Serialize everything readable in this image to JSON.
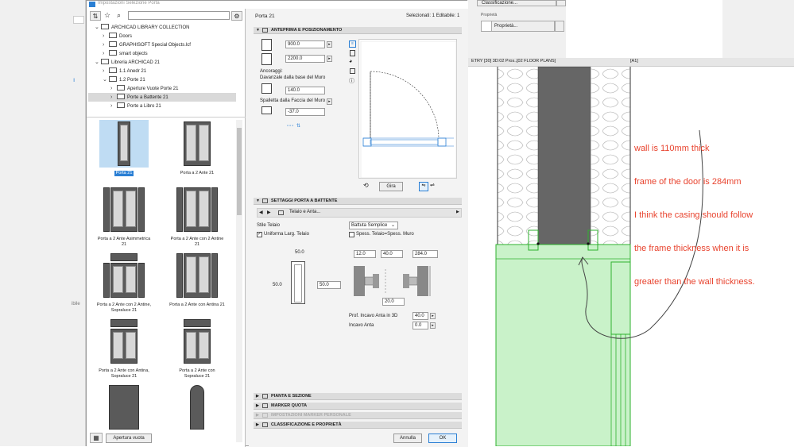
{
  "dialog": {
    "title": "Impostazioni Selezione Porta",
    "selection_info": "Selezionati: 1 Editabile: 1",
    "object_name": "Porta 21"
  },
  "library_tree": [
    {
      "label": "ARCHICAD LIBRARY COLLECTION",
      "indent": 0,
      "expanded": true,
      "selected": false
    },
    {
      "label": "Doors",
      "indent": 1,
      "expanded": false,
      "selected": false
    },
    {
      "label": "GRAPHISOFT Special Objects.lcf",
      "indent": 1,
      "expanded": false,
      "selected": false
    },
    {
      "label": "smart objects",
      "indent": 1,
      "expanded": false,
      "selected": false
    },
    {
      "label": "Libreria ARCHICAD 21",
      "indent": 0,
      "expanded": true,
      "selected": false
    },
    {
      "label": "1.1 Anedr 21",
      "indent": 1,
      "expanded": false,
      "selected": false
    },
    {
      "label": "1.2 Porte 21",
      "indent": 1,
      "expanded": true,
      "selected": false
    },
    {
      "label": "Aperture Vuote Porte 21",
      "indent": 2,
      "expanded": false,
      "selected": false
    },
    {
      "label": "Porte a Battente 21",
      "indent": 2,
      "expanded": false,
      "selected": true
    },
    {
      "label": "Porte a Libro 21",
      "indent": 2,
      "expanded": false,
      "selected": false
    }
  ],
  "thumbnails": [
    {
      "caption": "Porta 21",
      "selected": true
    },
    {
      "caption": "Porta a 2 Ante 21",
      "selected": false
    },
    {
      "caption": "Porta a 2 Ante Asimmetrica 21",
      "selected": false
    },
    {
      "caption": "Porta a 2 Ante con 2 Antine 21",
      "selected": false
    },
    {
      "caption": "Porta a 2 Ante con 2 Antine, Sopraluce 21",
      "selected": false
    },
    {
      "caption": "Porta a 2 Ante con Antina 21",
      "selected": false
    },
    {
      "caption": "Porta a 2 Ante con Antina, Sopraluce 21",
      "selected": false
    },
    {
      "caption": "Porta a 2 Ante con Sopraluce 21",
      "selected": false
    }
  ],
  "bottom_left_button": "Apertura vuota",
  "preview_section": {
    "title": "ANTEPRIMA E POSIZIONAMENTO",
    "width_value": "900.0",
    "height_value": "2200.0",
    "anchor_label": "Ancoraggi:",
    "sill_label": "Davanzale dalla base del Muro",
    "sill_value": "140.0",
    "reveal_label": "Spalletta dalla Faccia del Muro",
    "reveal_value": "-37.0",
    "rotate_button": "Gira"
  },
  "door_settings": {
    "title": "SETTAGGI PORTA A BATTENTE",
    "page_label": "Telaio e Anta...",
    "frame_style_label": "Stile Telaio",
    "frame_style_value": "Battuta Semplice",
    "uniform_label": "Uniforma Larg. Telaio",
    "uniform_checked": true,
    "thickness_label": "Spess. Telaio=Spess. Muro",
    "thickness_checked": false,
    "frame_top": "50.0",
    "frame_left": "50.0",
    "frame_right": "50.0",
    "dim1": "12.0",
    "dim2": "40.0",
    "dim3": "284.0",
    "dim4": "20.0",
    "recess_3d_label": "Prof. Incavo Anta in 3D",
    "recess_3d_value": "40.0",
    "recess_label": "Incavo Anta",
    "recess_value": "0.0"
  },
  "collapsed_sections": [
    {
      "label": "PIANTA E SEZIONE",
      "disabled": false
    },
    {
      "label": "MARKER QUOTA",
      "disabled": false
    },
    {
      "label": "IMPOSTAZIONI MARKER PERSONALE",
      "disabled": true
    },
    {
      "label": "CLASSIFICAZIONE E PROPRIETÀ",
      "disabled": false
    }
  ],
  "buttons": {
    "cancel": "Annulla",
    "ok": "OK"
  },
  "background_ui": {
    "classification": "Classificazione...",
    "properties_label": "Proprietà",
    "properties_value": "Proprietà...",
    "tab1": "ETRY [30] 3D:02 Pros...",
    "tab2": "[02 FLOOR PLANS]",
    "tab3": "[A1]",
    "side_label": "ibile"
  },
  "annotation": {
    "lines": [
      "wall is 110mm thick",
      "frame of the door is 284mm",
      "I think the casing should follow",
      "the frame thickness when it is",
      "greater than the wall thickness."
    ],
    "color": "#e8432e"
  },
  "colors": {
    "selection_blue": "#2a7fd4",
    "door_green": "#2fb12f",
    "green_fill": "#c9f2c9"
  }
}
